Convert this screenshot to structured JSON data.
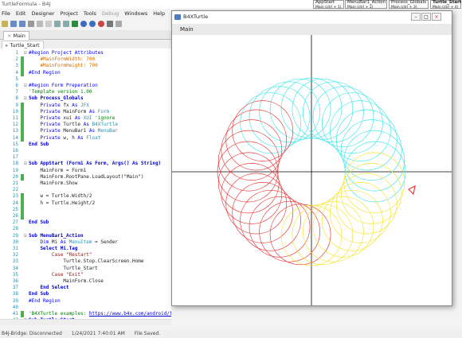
{
  "ide": {
    "title": "TurtleFormula - B4J",
    "menu": [
      "File",
      "Edit",
      "Designer",
      "Project",
      "Tools",
      "Debug",
      "Windows",
      "Help"
    ],
    "disabled_menu": "Debug",
    "tab_main": "Main",
    "module_tab": "Turtle_Start",
    "status": {
      "bridge": "B4J-Bridge: Disconnected",
      "saved_at": "1/24/2021 7:40:01 AM",
      "file_state": "File Saved."
    },
    "quick_tabs": [
      {
        "name": "AppStart",
        "sub": "Main (ctrl + 1)"
      },
      {
        "name": "MenuBar1_Action",
        "sub": "Main (ctrl + 2)"
      },
      {
        "name": "Process_Globals",
        "sub": "Main (ctrl + 3)"
      },
      {
        "name": "Turtle_Start",
        "sub": "Main (ctrl + 4)"
      }
    ]
  },
  "code_lines": [
    {
      "n": "1",
      "text": "#Region Project Attributes",
      "style": "kw",
      "fold": "-"
    },
    {
      "n": "2",
      "text": "    #MainFormWidth: 700",
      "style": "a"
    },
    {
      "n": "3",
      "text": "    #MainFormHeight: 700",
      "style": "a"
    },
    {
      "n": "4",
      "text": "#End Region",
      "style": "kw"
    },
    {
      "n": "5",
      "text": ""
    },
    {
      "n": "6",
      "text": "#Region Form Preperation",
      "style": "kw",
      "fold": "-"
    },
    {
      "n": "7",
      "text": "'Template version 1.00",
      "style": "c"
    },
    {
      "n": "8",
      "text": "Sub Process_Globals",
      "style": "k",
      "fold": "-"
    },
    {
      "n": "9",
      "text": "    Private fx As JFX",
      "style": "decl"
    },
    {
      "n": "10",
      "text": "    Private MainForm As Form",
      "style": "decl"
    },
    {
      "n": "11",
      "text": "    Private xui As XUI 'ignore",
      "style": "decl"
    },
    {
      "n": "12",
      "text": "    Private Turtle As B4XTurtle",
      "style": "decl"
    },
    {
      "n": "13",
      "text": "    Private MenuBar1 As MenuBar",
      "style": "decl"
    },
    {
      "n": "14",
      "text": "    Private w, h As Float",
      "style": "decl"
    },
    {
      "n": "15",
      "text": "End Sub",
      "style": "k"
    },
    {
      "n": "16",
      "text": ""
    },
    {
      "n": "17",
      "text": ""
    },
    {
      "n": "18",
      "text": "Sub AppStart (Form1 As Form, Args() As String)",
      "style": "k",
      "fold": "-"
    },
    {
      "n": "19",
      "text": "    MainForm = Form1",
      "style": "plain"
    },
    {
      "n": "20",
      "text": "    MainForm.RootPane.LoadLayout(\"Main\")",
      "style": "plain"
    },
    {
      "n": "21",
      "text": "    MainForm.Show",
      "style": "plain"
    },
    {
      "n": "22",
      "text": ""
    },
    {
      "n": "23",
      "text": "    w = Turtle.Width/2",
      "style": "plain"
    },
    {
      "n": "24",
      "text": "    h = Turtle.Height/2",
      "style": "plain"
    },
    {
      "n": "25",
      "text": ""
    },
    {
      "n": "26",
      "text": ""
    },
    {
      "n": "27",
      "text": "End Sub",
      "style": "k"
    },
    {
      "n": "28",
      "text": ""
    },
    {
      "n": "29",
      "text": "Sub MenuBar1_Action",
      "style": "k",
      "fold": "-"
    },
    {
      "n": "30",
      "text": "    Dim Mi As MenuItem = Sender",
      "style": "decl"
    },
    {
      "n": "31",
      "text": "    Select Mi.Tag",
      "style": "k"
    },
    {
      "n": "32",
      "text": "        Case \"Restart\"",
      "style": "s"
    },
    {
      "n": "33",
      "text": "            Turtle.Stop.ClearScreen.Home",
      "style": "plain"
    },
    {
      "n": "34",
      "text": "            Turtle_Start",
      "style": "plain"
    },
    {
      "n": "35",
      "text": "        Case \"Exit\"",
      "style": "s"
    },
    {
      "n": "36",
      "text": "            MainForm.Close",
      "style": "plain"
    },
    {
      "n": "37",
      "text": "    End Select",
      "style": "k"
    },
    {
      "n": "38",
      "text": "End Sub",
      "style": "k"
    },
    {
      "n": "39",
      "text": "#End Region",
      "style": "kw"
    },
    {
      "n": "40",
      "text": ""
    },
    {
      "n": "41",
      "text": "'B4XTurtle examples: https://www.b4x.com/android/forum/threads/b4xturtle-examples.",
      "style": "c"
    },
    {
      "n": "42",
      "text": "Sub Turtle_Start",
      "style": "k",
      "fold": "-"
    }
  ],
  "window": {
    "title": "B4XTurtle",
    "menu_label": "Main",
    "colors": {
      "red": "#e83a3a",
      "cyan": "#3ee6ea",
      "yellow": "#f5e432",
      "axis": "#000000"
    }
  }
}
